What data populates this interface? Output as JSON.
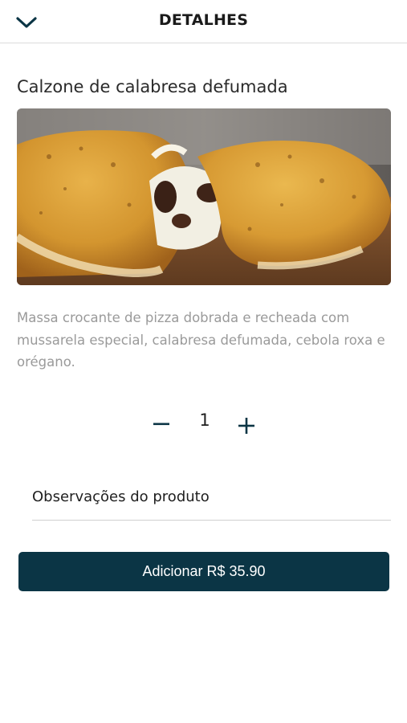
{
  "header": {
    "title": "DETALHES",
    "back_icon": "chevron-down-icon"
  },
  "product": {
    "name": "Calzone de calabresa defumada",
    "description": "Massa crocante de pizza dobrada e recheada com mussarela especial, calabresa defumada, cebola roxa e orégano."
  },
  "quantity": {
    "value": "1",
    "minus_icon": "minus-icon",
    "plus_icon": "plus-icon"
  },
  "observations": {
    "placeholder": "Observações do produto",
    "value": ""
  },
  "add_button": {
    "label": "Adicionar R$ 35.90"
  },
  "colors": {
    "accent": "#0b3545",
    "description_text": "#9a9a9a"
  }
}
